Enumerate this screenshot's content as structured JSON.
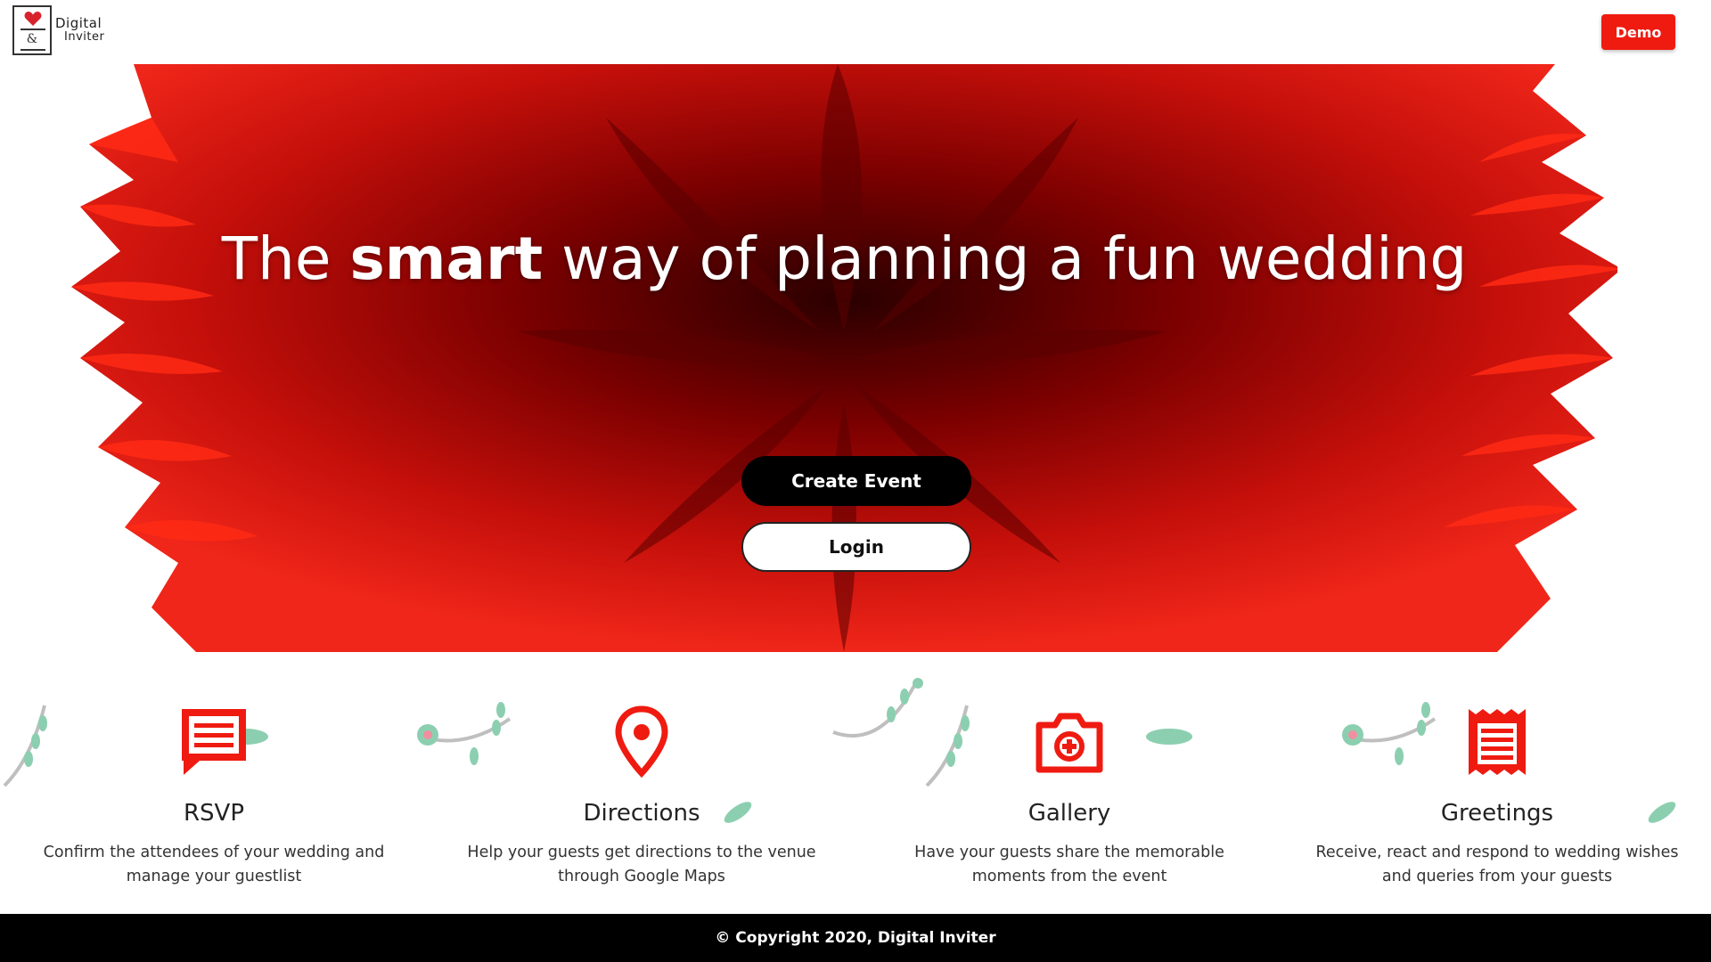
{
  "header": {
    "logo_line1": "Digital",
    "logo_line2": "Inviter",
    "logo_amp": "&",
    "demo_label": "Demo"
  },
  "hero": {
    "title_before": "The ",
    "title_bold": "smart",
    "title_after": " way of planning a fun wedding",
    "create_label": "Create Event",
    "login_label": "Login"
  },
  "features": [
    {
      "icon": "chat-icon",
      "title": "RSVP",
      "desc": "Confirm the attendees of your wedding and manage your guestlist"
    },
    {
      "icon": "map-pin-icon",
      "title": "Directions",
      "desc": "Help your guests get directions to the venue through Google Maps"
    },
    {
      "icon": "camera-icon",
      "title": "Gallery",
      "desc": "Have your guests share the memorable moments from the event"
    },
    {
      "icon": "receipt-icon",
      "title": "Greetings",
      "desc": "Receive, react and respond to wedding wishes and queries from your guests"
    }
  ],
  "footer": {
    "copyright": "© Copyright 2020, Digital Inviter"
  },
  "colors": {
    "accent": "#ef1b11",
    "hero_dark": "#3a0000",
    "leaf": "#8ccfb0"
  }
}
